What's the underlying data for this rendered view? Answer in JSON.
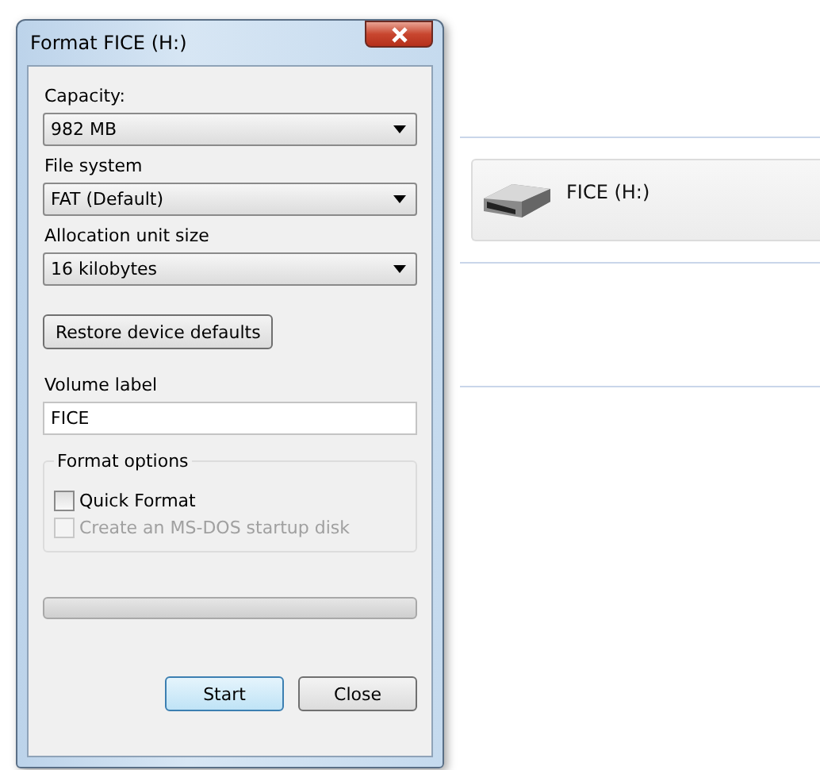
{
  "window": {
    "title": "Format FICE (H:)"
  },
  "fields": [
    {
      "label": "Capacity:",
      "value": "982 MB"
    },
    {
      "label": "File system",
      "value": "FAT (Default)"
    },
    {
      "label": "Allocation unit size",
      "value": "16 kilobytes"
    }
  ],
  "restore_button": "Restore device defaults",
  "volume_label": {
    "label": "Volume label",
    "value": "FICE"
  },
  "format_options": {
    "title": "Format options",
    "options": [
      {
        "label": "Quick Format",
        "checked": false,
        "disabled": false
      },
      {
        "label": "Create an MS-DOS startup disk",
        "checked": false,
        "disabled": true
      }
    ]
  },
  "progress": {
    "level": 0
  },
  "buttons": [
    {
      "label": "Start",
      "default": true
    },
    {
      "label": "Close",
      "default": false
    }
  ],
  "explorer": {
    "drives": [
      {
        "name": "FICE (H:)"
      }
    ]
  }
}
